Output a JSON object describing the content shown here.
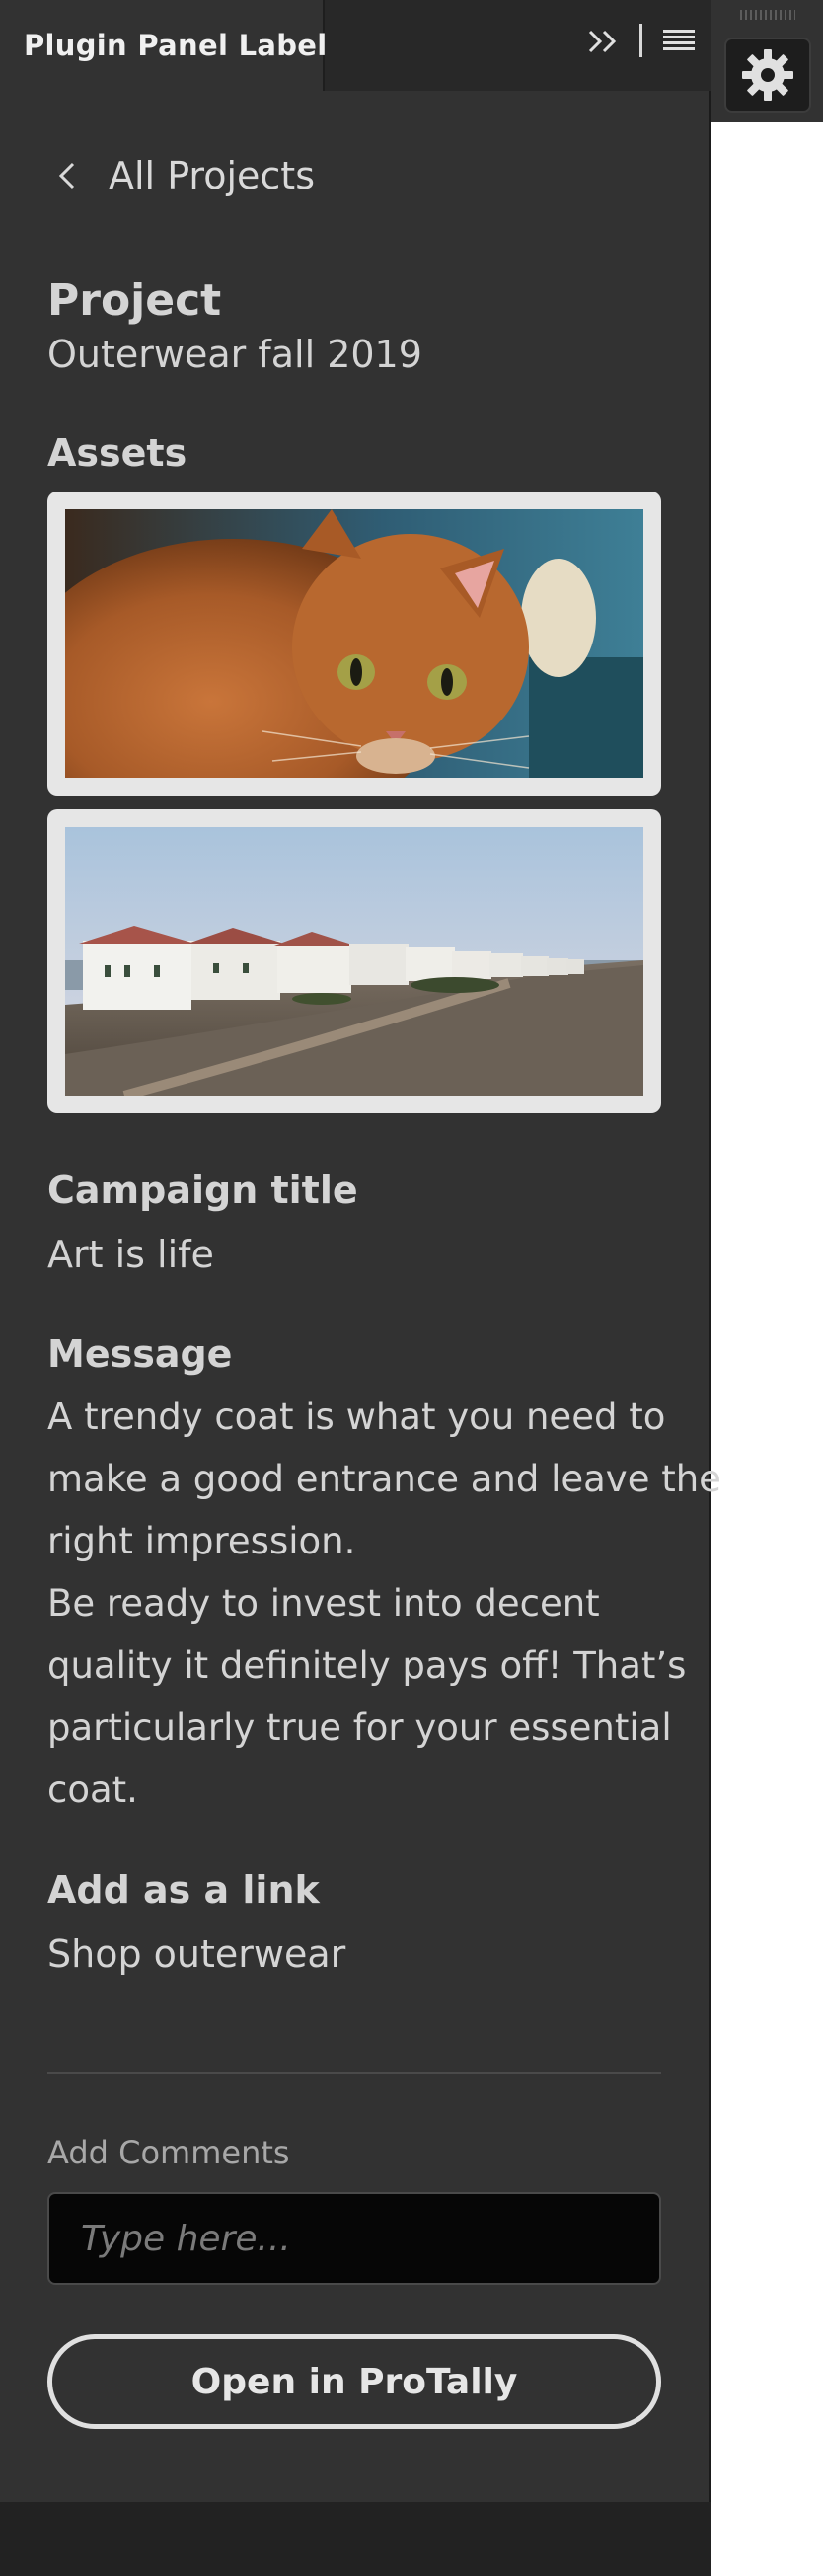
{
  "panel": {
    "tab_label": "Plugin Panel Label",
    "collapse_icon": "double-chevron-right-icon",
    "menu_icon": "hamburger-menu-icon"
  },
  "dock": {
    "settings_icon": "gear-icon"
  },
  "nav": {
    "back_label": "All Projects",
    "back_icon": "chevron-left-icon"
  },
  "project": {
    "heading": "Project",
    "name": "Outerwear fall 2019"
  },
  "assets": {
    "heading": "Assets",
    "items": [
      {
        "name": "cat-photo"
      },
      {
        "name": "coastal-houses-photo"
      }
    ]
  },
  "campaign": {
    "heading": "Campaign title",
    "value": "Art is life"
  },
  "message": {
    "heading": "Message",
    "lines": [
      "A trendy coat is what you need to",
      "make a good entrance and leave the",
      "right impression.",
      "Be ready to invest into decent",
      "quality it definitely pays off! That’s",
      "particularly true for your essential",
      "coat."
    ]
  },
  "link": {
    "heading": "Add as a link",
    "value": "Shop outerwear"
  },
  "comments": {
    "label": "Add Comments",
    "placeholder": "Type here...",
    "value": ""
  },
  "actions": {
    "open_label": "Open in ProTally"
  },
  "colors": {
    "panel_bg": "#323232",
    "header_bg": "#282828",
    "text": "#d4d4d4",
    "input_bg": "#060606"
  }
}
